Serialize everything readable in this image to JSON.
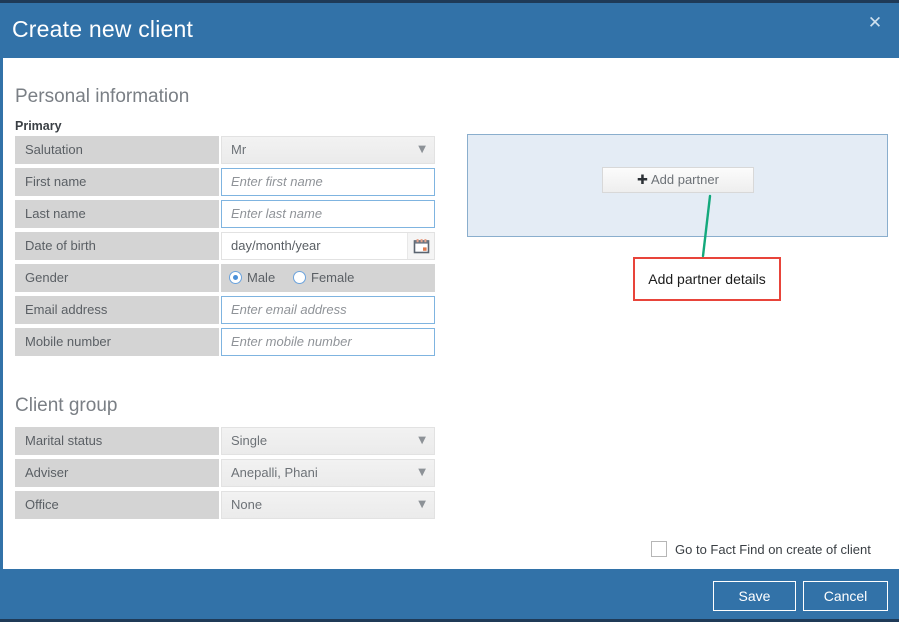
{
  "window": {
    "title": "Create new client",
    "close_label": "✕",
    "close_icon": "close-icon",
    "accent_color": "#3272a8",
    "header_border_color": "#1f3a57"
  },
  "personal": {
    "section_title": "Personal information",
    "sub_title": "Primary",
    "fields": [
      {
        "label": "Salutation",
        "type": "select",
        "value": "Mr",
        "caret": "▼"
      },
      {
        "label": "First name",
        "type": "text",
        "placeholder": "Enter first name"
      },
      {
        "label": "Last name",
        "type": "text",
        "placeholder": "Enter last name"
      },
      {
        "label": "Date of birth",
        "type": "date",
        "value": "day/month/year",
        "icon": "calendar-icon"
      },
      {
        "label": "Gender",
        "type": "radio",
        "options": [
          "Male",
          "Female"
        ],
        "selected": "Male"
      },
      {
        "label": "Email address",
        "type": "text",
        "placeholder": "Enter email address"
      },
      {
        "label": "Mobile number",
        "type": "text",
        "placeholder": "Enter mobile number"
      }
    ]
  },
  "client_group": {
    "section_title": "Client group",
    "fields": [
      {
        "label": "Marital status",
        "type": "select",
        "value": "Single",
        "caret": "▼"
      },
      {
        "label": "Adviser",
        "type": "select",
        "value": "Anepalli, Phani",
        "caret": "▼"
      },
      {
        "label": "Office",
        "type": "select",
        "value": "None",
        "caret": "▼"
      }
    ]
  },
  "partner_panel": {
    "add_partner_label": "Add partner",
    "plus_icon": "➕",
    "plus_glyph": "➕",
    "panel_bg": "#e4ecf5",
    "panel_border": "#8aaecd"
  },
  "annotation": {
    "text": "Add partner details",
    "border_color": "#e8443a",
    "arrow_color": "#13a97c"
  },
  "options": {
    "fact_find_label": "Go to Fact Find on create of client",
    "fact_find_checked": false
  },
  "footer": {
    "save_label": "Save",
    "cancel_label": "Cancel"
  }
}
